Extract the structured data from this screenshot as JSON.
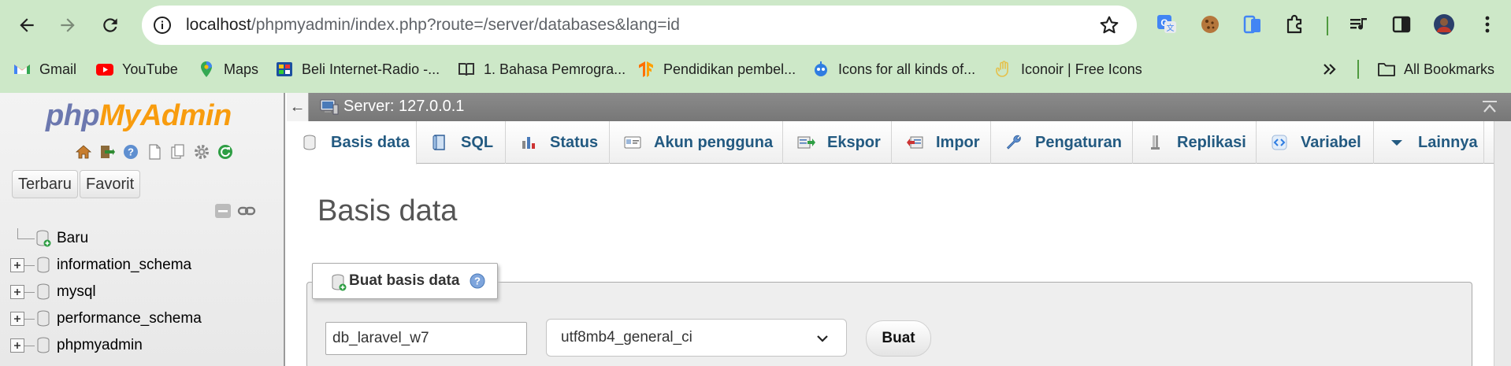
{
  "browser": {
    "url_host": "localhost",
    "url_path": "/phpmyadmin/index.php?route=/server/databases&lang=id",
    "bookmarks": [
      {
        "label": "Gmail",
        "icon": "gmail-icon"
      },
      {
        "label": "YouTube",
        "icon": "youtube-icon"
      },
      {
        "label": "Maps",
        "icon": "maps-icon"
      },
      {
        "label": "Beli Internet-Radio -...",
        "icon": "radio-icon"
      },
      {
        "label": "1. Bahasa Pemrogra...",
        "icon": "book-icon"
      },
      {
        "label": "Pendidikan pembel...",
        "icon": "tensorflow-icon"
      },
      {
        "label": "Icons for all kinds of...",
        "icon": "robot-icon"
      },
      {
        "label": "Iconoir | Free Icons",
        "icon": "hand-icon"
      }
    ],
    "all_bookmarks": "All Bookmarks"
  },
  "sidebar": {
    "logo_php": "php",
    "logo_my": "My",
    "logo_admin": "Admin",
    "recent_btn": "Terbaru",
    "favorites_btn": "Favorit",
    "tree": [
      {
        "label": "Baru"
      },
      {
        "label": "information_schema"
      },
      {
        "label": "mysql"
      },
      {
        "label": "performance_schema"
      },
      {
        "label": "phpmyadmin"
      }
    ]
  },
  "server_bar": {
    "text": "Server: 127.0.0.1",
    "back": "←"
  },
  "tabs": [
    {
      "label": "Basis data",
      "icon": "database-icon",
      "active": true
    },
    {
      "label": "SQL",
      "icon": "sql-icon"
    },
    {
      "label": "Status",
      "icon": "status-icon"
    },
    {
      "label": "Akun pengguna",
      "icon": "users-icon"
    },
    {
      "label": "Ekspor",
      "icon": "export-icon"
    },
    {
      "label": "Impor",
      "icon": "import-icon"
    },
    {
      "label": "Pengaturan",
      "icon": "wrench-icon"
    },
    {
      "label": "Replikasi",
      "icon": "replication-icon"
    },
    {
      "label": "Variabel",
      "icon": "variables-icon"
    },
    {
      "label": "Lainnya",
      "icon": "more-icon"
    }
  ],
  "main": {
    "title": "Basis data",
    "create_legend": "Buat basis data",
    "db_name_value": "db_laravel_w7",
    "collation_value": "utf8mb4_general_ci",
    "create_button": "Buat"
  },
  "colors": {
    "chrome_bg": "#cde8c8",
    "tab_text": "#235a81",
    "logo_blue": "#6c78af",
    "logo_orange": "#f89c0e"
  }
}
